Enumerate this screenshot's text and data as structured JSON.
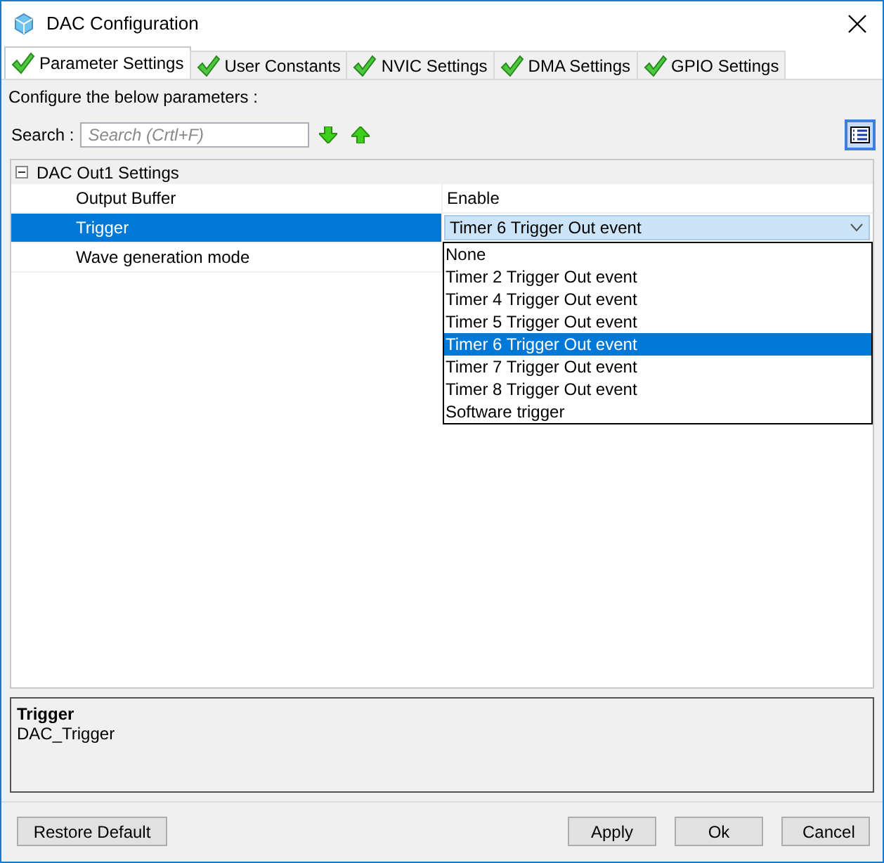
{
  "window": {
    "title": "DAC Configuration"
  },
  "tabs": [
    {
      "label": "Parameter Settings",
      "selected": true
    },
    {
      "label": "User Constants",
      "selected": false
    },
    {
      "label": "NVIC Settings",
      "selected": false
    },
    {
      "label": "DMA Settings",
      "selected": false
    },
    {
      "label": "GPIO Settings",
      "selected": false
    }
  ],
  "instructions": "Configure the below parameters :",
  "search": {
    "label": "Search :",
    "placeholder": "Search (Crtl+F)"
  },
  "view_toggle": {
    "on": true
  },
  "groups": [
    {
      "label": "DAC Out1 Settings",
      "expanded": true,
      "children": [
        {
          "name": "Output Buffer",
          "value": "Enable",
          "selected": false
        },
        {
          "name": "Trigger",
          "value": "Timer 6 Trigger Out event",
          "selected": true,
          "dropdown": {
            "options": [
              {
                "label": "None",
                "selected": false
              },
              {
                "label": "Timer 2 Trigger Out event",
                "selected": false
              },
              {
                "label": "Timer 4 Trigger Out event",
                "selected": false
              },
              {
                "label": "Timer 5 Trigger Out event",
                "selected": false
              },
              {
                "label": "Timer 6 Trigger Out event",
                "selected": true
              },
              {
                "label": "Timer 7 Trigger Out event",
                "selected": false
              },
              {
                "label": "Timer 8 Trigger Out event",
                "selected": false
              },
              {
                "label": "Software trigger",
                "selected": false
              }
            ]
          }
        },
        {
          "name": "Wave generation mode",
          "selected": false
        }
      ]
    }
  ],
  "description": {
    "title": "Trigger",
    "text": "DAC_Trigger"
  },
  "buttons": {
    "left": [
      "Restore Default"
    ],
    "right": [
      "Apply",
      "Ok",
      "Cancel"
    ]
  }
}
